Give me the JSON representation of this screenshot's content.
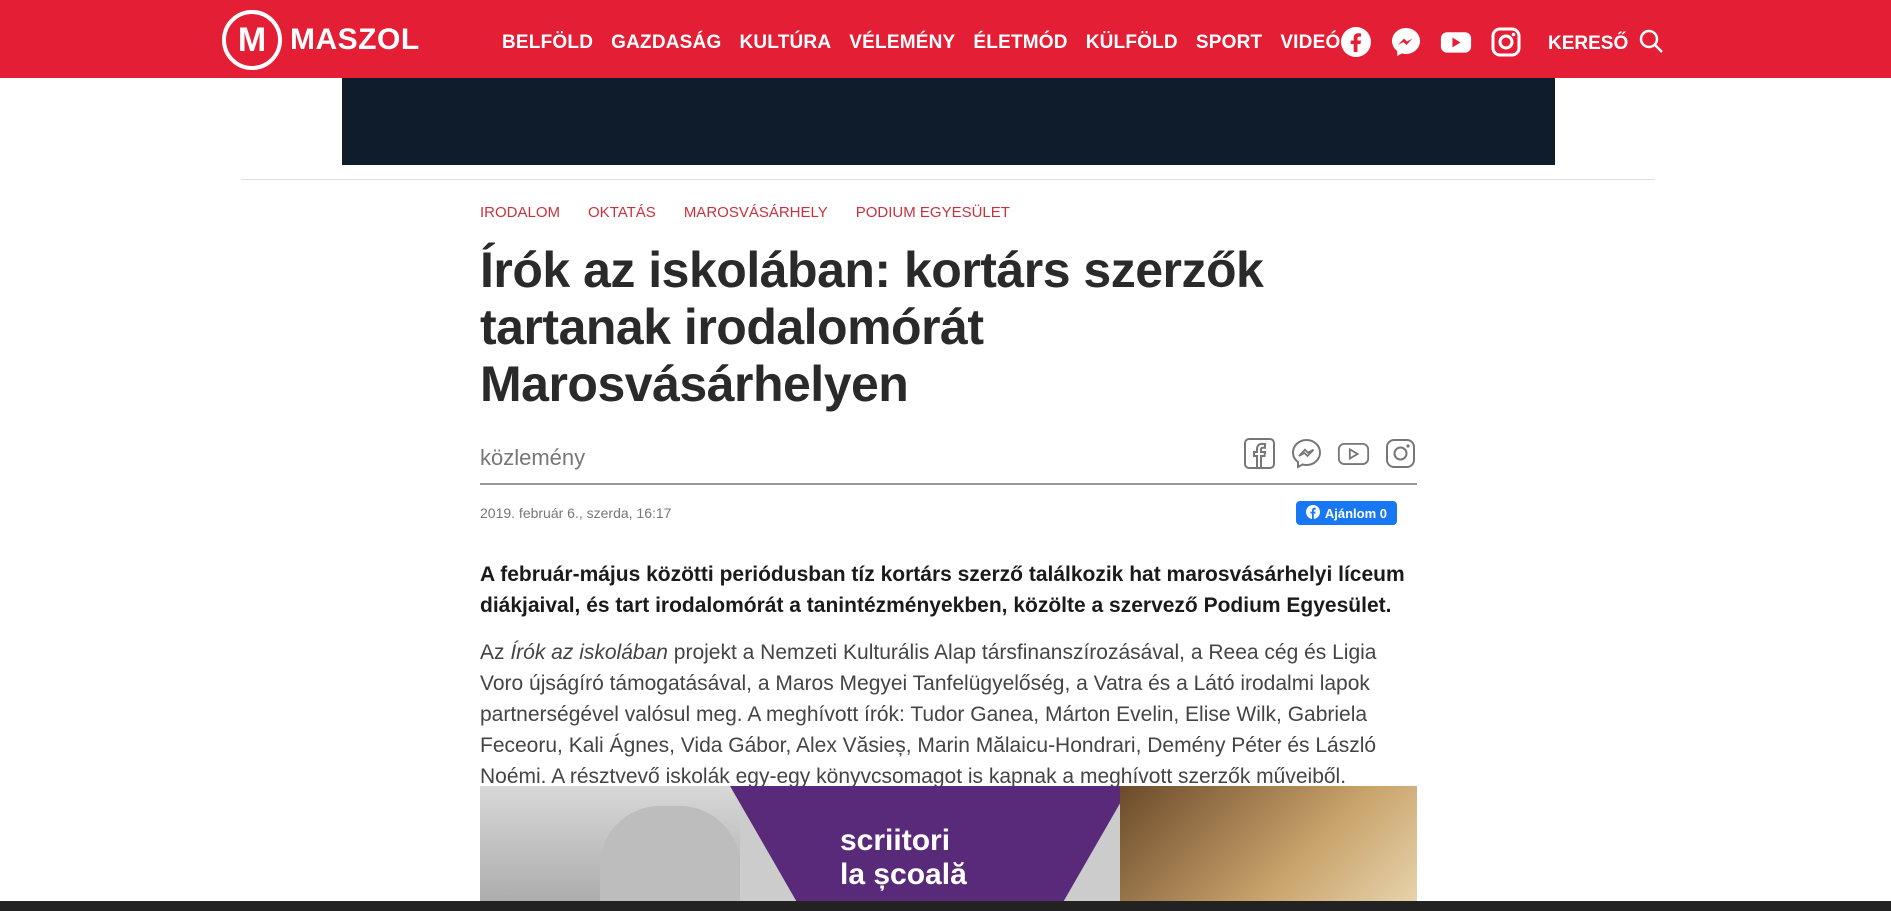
{
  "header": {
    "logo_mark": "M",
    "logo_text": "MASZOL",
    "nav": [
      "BELFÖLD",
      "GAZDASÁG",
      "KULTÚRA",
      "VÉLEMÉNY",
      "ÉLETMÓD",
      "KÜLFÖLD",
      "SPORT",
      "VIDEÓ"
    ],
    "search_label": "KERESŐ",
    "social_icons": [
      "facebook-icon",
      "messenger-icon",
      "youtube-icon",
      "instagram-icon"
    ]
  },
  "colors": {
    "brand": "#e31e35",
    "banner": "#0e1c2c",
    "tag": "#c8323c",
    "fb": "#1877f2"
  },
  "article": {
    "tags": [
      "IRODALOM",
      "OKTATÁS",
      "MAROSVÁSÁRHELY",
      "PODIUM EGYESÜLET"
    ],
    "title": "Írók az iskolában: kortárs szerzők tartanak irodalomórát Marosvásárhelyen",
    "byline": "közlemény",
    "date": "2019. február 6., szerda, 16:17",
    "fb_like_label": "Ajánlom 0",
    "lead": "A február-május közötti periódusban tíz kortárs szerző találkozik hat marosvásárhelyi líceum diákjaival, és tart irodalomórát a tanintézményekben, közölte a szervező Podium Egyesület.",
    "body_prefix": "Az ",
    "body_italic": "Írók az iskolában",
    "body_rest": " projekt a Nemzeti Kulturális Alap társfinanszírozásával, a Reea cég és Ligia Voro újságíró támogatásával, a Maros Megyei Tanfelügyelőség, a Vatra és a Látó irodalmi lapok partnerségével valósul meg. A meghívott írók: Tudor Ganea, Márton Evelin, Elise Wilk, Gabriela Feceoru, Kali Ágnes, Vida Gábor, Alex Văsieș, Marin Mălaicu-Hondrari, Demény Péter és László Noémi. A résztvevő iskolák egy-egy könyvcsomagot is kapnak a meghívott szerzők műveiből.",
    "image_text_line1": "scriitori",
    "image_text_line2": "la școală"
  }
}
